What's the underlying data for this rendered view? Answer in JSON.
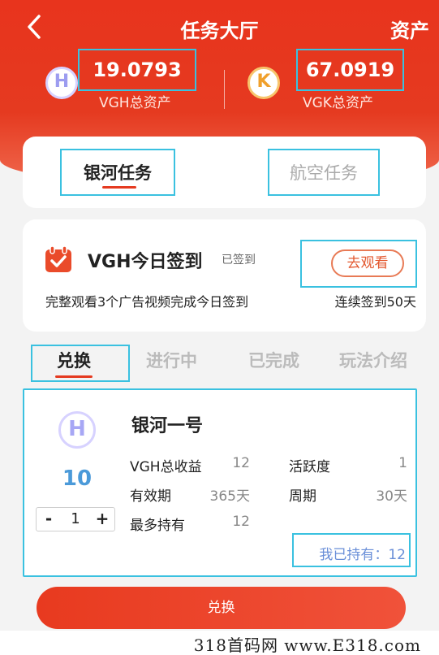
{
  "header": {
    "title": "任务大厅",
    "assets_link": "资产"
  },
  "assets": {
    "vgh": {
      "icon_letter": "H",
      "value": "19.0793",
      "label": "VGH总资产"
    },
    "vgk": {
      "icon_letter": "K",
      "value": "67.0919",
      "label": "VGK总资产"
    }
  },
  "task_tabs": [
    {
      "label": "银河任务",
      "active": true
    },
    {
      "label": "航空任务",
      "active": false
    }
  ],
  "checkin": {
    "title": "VGH今日签到",
    "status": "已签到",
    "watch_button": "去观看",
    "description": "完整观看3个广告视频完成今日签到",
    "streak": "连续签到50天"
  },
  "filter_tabs": [
    "兑换",
    "进行中",
    "已完成",
    "玩法介绍"
  ],
  "product": {
    "icon_letter": "H",
    "name": "银河一号",
    "price": "10",
    "quantity": "1",
    "minus": "-",
    "plus": "+",
    "props": [
      {
        "label": "VGH总收益",
        "value": "12"
      },
      {
        "label": "活跃度",
        "value": "1"
      },
      {
        "label": "有效期",
        "value": "365天"
      },
      {
        "label": "周期",
        "value": "30天"
      },
      {
        "label": "最多持有",
        "value": "12"
      }
    ],
    "owned": "我已持有：12"
  },
  "exchange_button": "兑换",
  "watermark": "318首码网 www.E318.com",
  "colors": {
    "brand_red": "#e53a20",
    "highlight": "#3ac1e0"
  }
}
